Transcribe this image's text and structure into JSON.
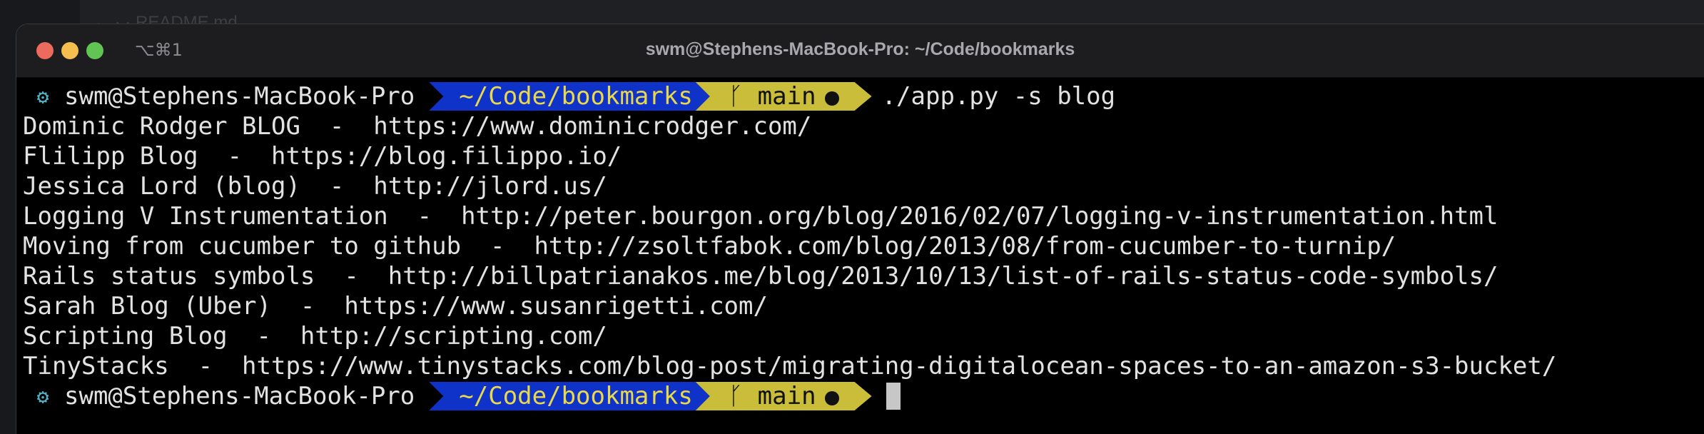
{
  "background": {
    "editor_text": "←  ·  · README.md"
  },
  "window": {
    "shortcut": "⌥⌘1",
    "title": "swm@Stephens-MacBook-Pro: ~/Code/bookmarks"
  },
  "prompt": {
    "user_host": "swm@Stephens-MacBook-Pro",
    "path": "~/Code/bookmarks",
    "branch": "main",
    "command": "./app.py -s blog"
  },
  "output": [
    "Dominic Rodger BLOG  -  https://www.dominicrodger.com/",
    "Flilipp Blog  -  https://blog.filippo.io/",
    "Jessica Lord (blog)  -  http://jlord.us/",
    "Logging V Instrumentation  -  http://peter.bourgon.org/blog/2016/02/07/logging-v-instrumentation.html",
    "Moving from cucumber to github  -  http://zsoltfabok.com/blog/2013/08/from-cucumber-to-turnip/",
    "Rails status symbols  -  http://billpatrianakos.me/blog/2013/10/13/list-of-rails-status-code-symbols/",
    "Sarah Blog (Uber)  -  https://www.susanrigetti.com/",
    "Scripting Blog  -  http://scripting.com/",
    "TinyStacks  -  https://www.tinystacks.com/blog-post/migrating-digitalocean-spaces-to-an-amazon-s3-bucket/"
  ],
  "prompt2": {
    "user_host": "swm@Stephens-MacBook-Pro",
    "path": "~/Code/bookmarks",
    "branch": "main"
  },
  "icons": {
    "gear": "gear-icon",
    "branch": "git-branch-icon",
    "dirty": "dirty-indicator-icon"
  },
  "colors": {
    "path_segment": "#0f32c9",
    "path_text": "#e8d84a",
    "git_segment": "#c9bd3a",
    "gear": "#4fb6c9"
  }
}
